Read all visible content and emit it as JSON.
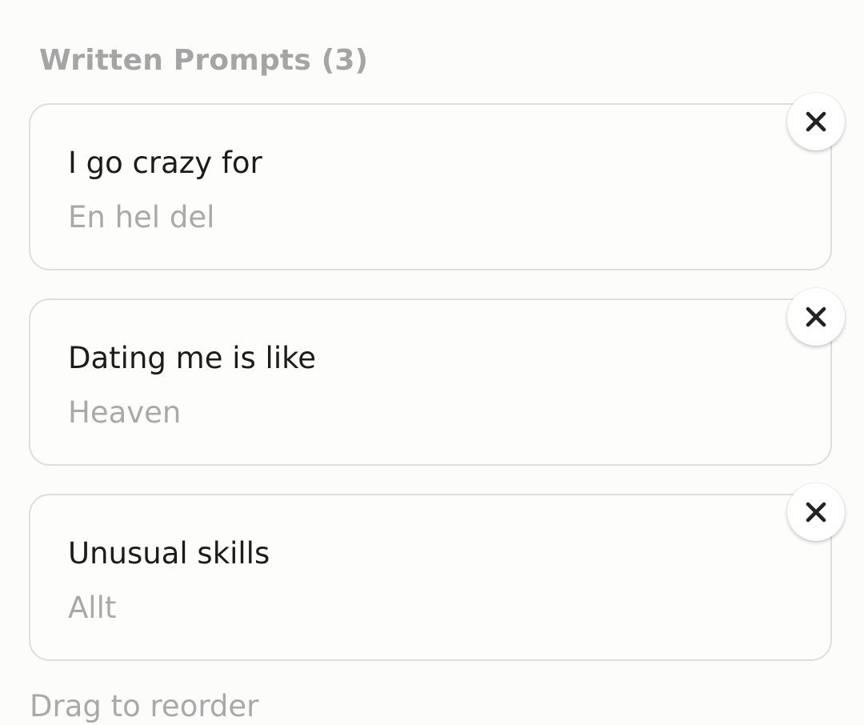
{
  "section": {
    "title": "Written Prompts (3)"
  },
  "prompts": [
    {
      "question": "I go crazy for",
      "answer": "En hel del"
    },
    {
      "question": "Dating me is like",
      "answer": "Heaven"
    },
    {
      "question": "Unusual skills",
      "answer": "Allt"
    }
  ],
  "footer": {
    "hint": "Drag to reorder"
  },
  "icons": {
    "remove": "close-icon"
  },
  "colors": {
    "background": "#fcfcfb",
    "card_border": "#dedede",
    "question_text": "#1c1c1c",
    "muted_text": "#a9a9a9",
    "icon": "#222222"
  }
}
